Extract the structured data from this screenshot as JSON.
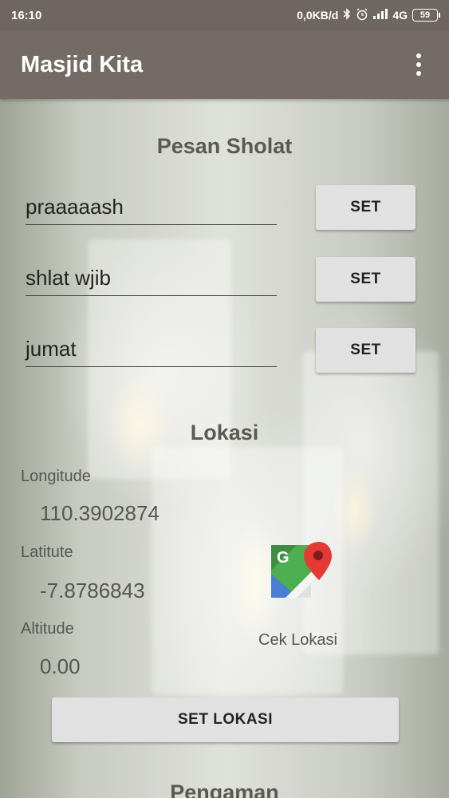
{
  "status_bar": {
    "time": "16:10",
    "network_speed": "0,0KB/d",
    "network_type": "4G",
    "battery": "59",
    "icons": [
      "bluetooth-icon",
      "alarm-icon",
      "signal-icon"
    ]
  },
  "app_bar": {
    "title": "Masjid Kita",
    "overflow_icon": "more-vert-icon",
    "background": "#746b66"
  },
  "pesan_sholat": {
    "title": "Pesan Sholat",
    "messages": [
      {
        "value": "praaaaash",
        "button": "SET"
      },
      {
        "value": "shlat wjib",
        "button": "SET"
      },
      {
        "value": "jumat",
        "button": "SET"
      }
    ]
  },
  "lokasi": {
    "title": "Lokasi",
    "longitude_label": "Longitude",
    "longitude_value": "110.3902874",
    "latitude_label": "Latitute",
    "latitude_value": "-7.8786843",
    "altitude_label": "Altitude",
    "altitude_value": "0.00",
    "maps_icon": "google-maps-icon",
    "cek_lokasi_label": "Cek Lokasi",
    "set_lokasi_button": "SET LOKASI"
  },
  "pengaman": {
    "title": "Pengaman"
  }
}
